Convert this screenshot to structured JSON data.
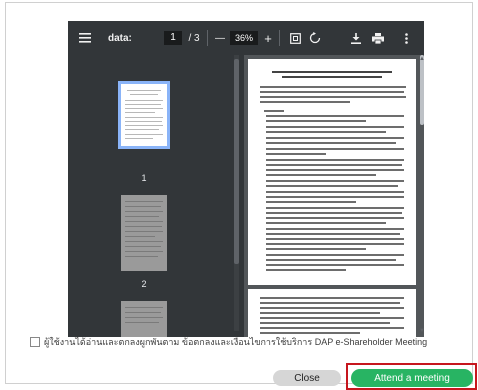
{
  "viewer": {
    "filename": "data:",
    "current_page": "1",
    "page_sep": "/ 3",
    "zoom_out": "—",
    "zoom": "36%",
    "zoom_in": "+",
    "thumbnails": [
      {
        "number": "1"
      },
      {
        "number": "2"
      }
    ]
  },
  "agreement": {
    "text": "ผู้ใช้งานได้อ่านและตกลงผูกพันตาม ข้อตกลงและเงื่อนไขการใช้บริการ DAP e-Shareholder Meeting"
  },
  "buttons": {
    "close": "Close",
    "attend": "Attend a meeting"
  },
  "colors": {
    "toolbar": "#323639",
    "viewer_bg": "#525659",
    "attend": "#28b463",
    "highlight": "#c6161e"
  },
  "icons": [
    "menu-icon",
    "fit-page-icon",
    "rotate-icon",
    "download-icon",
    "print-icon",
    "more-icon"
  ]
}
